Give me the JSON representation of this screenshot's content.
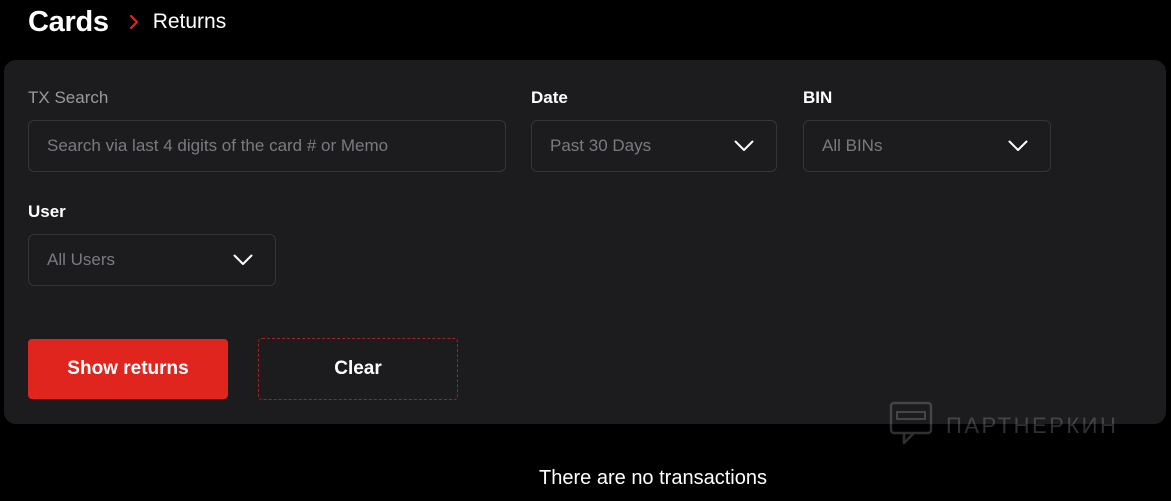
{
  "breadcrumb": {
    "root": "Cards",
    "current": "Returns"
  },
  "filters": {
    "tx_search": {
      "label": "TX Search",
      "placeholder": "Search via last 4 digits of the card # or Memo",
      "value": ""
    },
    "date": {
      "label": "Date",
      "selected": "Past 30 Days"
    },
    "bin": {
      "label": "BIN",
      "selected": "All BINs"
    },
    "user": {
      "label": "User",
      "selected": "All Users"
    }
  },
  "actions": {
    "show_returns": "Show returns",
    "clear": "Clear"
  },
  "watermark": {
    "text": "ПАРТНЕРКИН"
  },
  "empty_state": {
    "message": "There are no transactions"
  },
  "colors": {
    "accent": "#e0251e",
    "panel": "#1c1c1e",
    "background": "#000000"
  }
}
